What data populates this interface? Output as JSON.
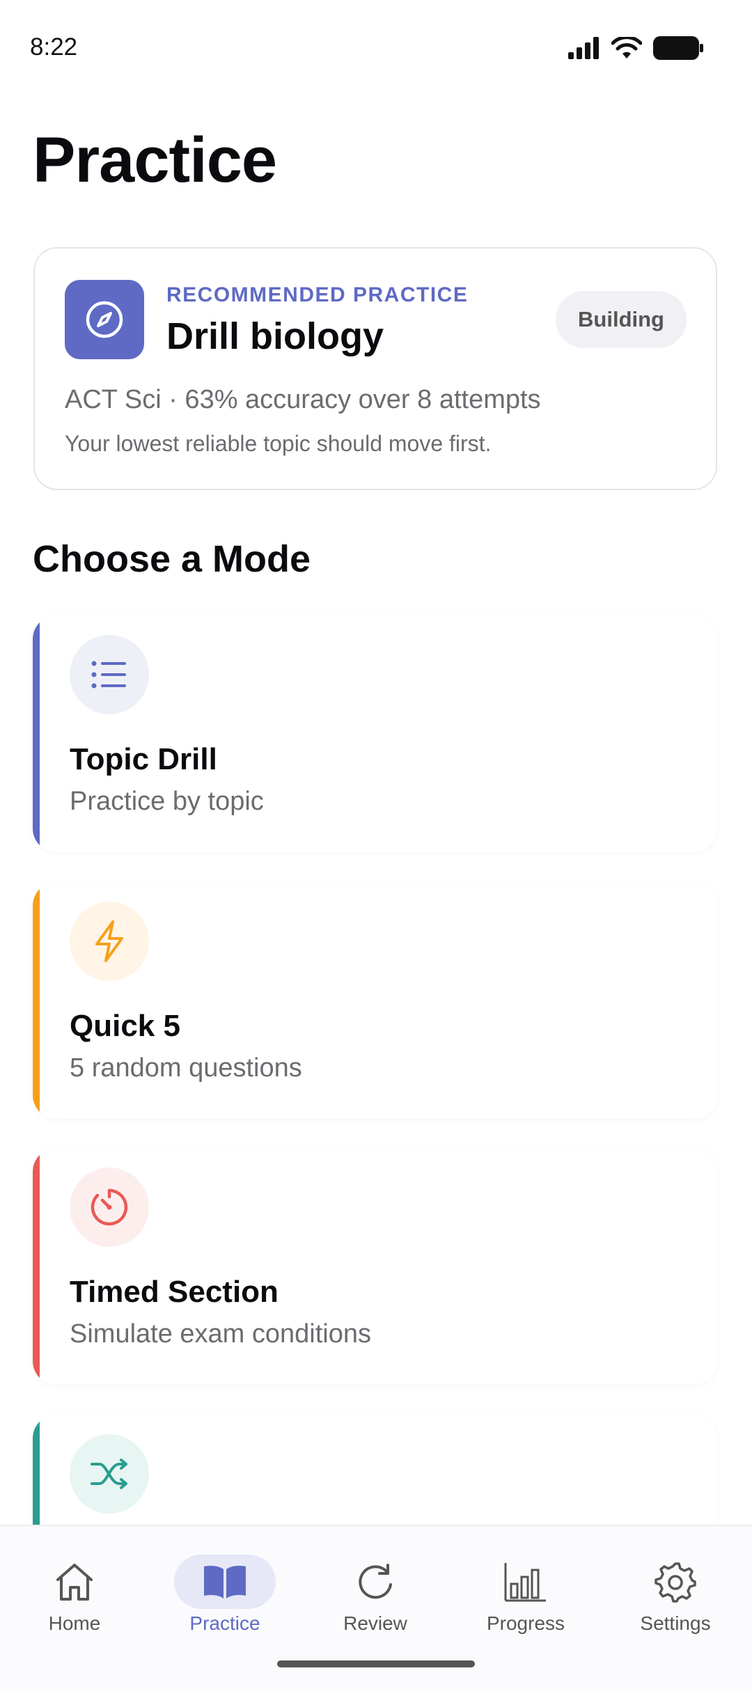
{
  "status_bar": {
    "time": "8:22"
  },
  "page": {
    "title": "Practice"
  },
  "recommended": {
    "kicker": "RECOMMENDED PRACTICE",
    "title": "Drill biology",
    "badge": "Building",
    "meta": "ACT Sci · 63% accuracy over 8 attempts",
    "note": "Your lowest reliable topic should move first.",
    "icon": "compass-icon"
  },
  "section": {
    "title": "Choose a Mode"
  },
  "modes": [
    {
      "title": "Topic Drill",
      "subtitle": "Practice by topic",
      "icon": "list-icon",
      "accent": "#5e6ac4",
      "icon_bg": "#eef0f8"
    },
    {
      "title": "Quick 5",
      "subtitle": "5 random questions",
      "icon": "lightning-icon",
      "accent": "#f5a01c",
      "icon_bg": "#fff4e6"
    },
    {
      "title": "Timed Section",
      "subtitle": "Simulate exam conditions",
      "icon": "timer-icon",
      "accent": "#e85a55",
      "icon_bg": "#fdeeee"
    },
    {
      "title": "",
      "subtitle": "",
      "icon": "shuffle-icon",
      "accent": "#2a9d8f",
      "icon_bg": "#e8f6f3"
    }
  ],
  "nav": {
    "items": [
      {
        "label": "Home",
        "icon": "home-icon",
        "active": false
      },
      {
        "label": "Practice",
        "icon": "book-icon",
        "active": true
      },
      {
        "label": "Review",
        "icon": "refresh-icon",
        "active": false
      },
      {
        "label": "Progress",
        "icon": "bar-chart-icon",
        "active": false
      },
      {
        "label": "Settings",
        "icon": "gear-icon",
        "active": false
      }
    ]
  },
  "colors": {
    "accent": "#5e6ac4"
  }
}
